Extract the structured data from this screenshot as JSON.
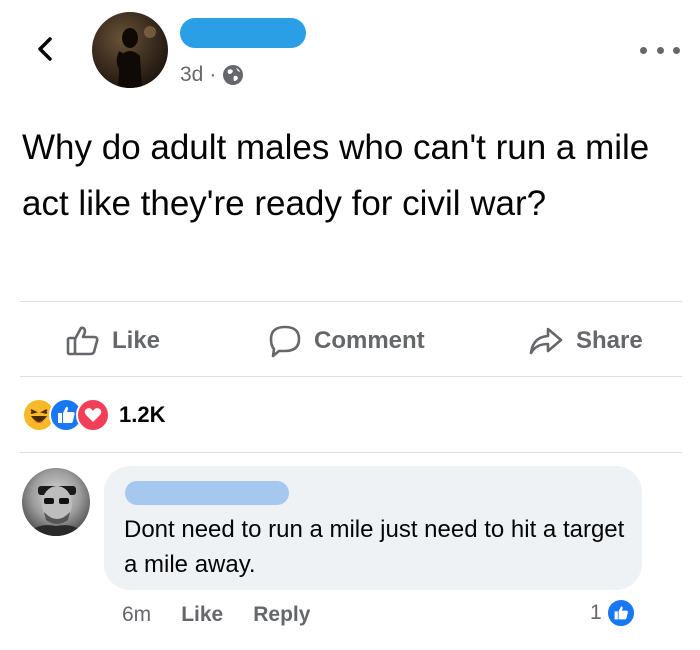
{
  "post": {
    "time": "3d",
    "separator": "·",
    "audience_icon": "globe-icon",
    "text": "Why do adult males who can't run a mile act like they're ready for civil war?"
  },
  "actions": {
    "like_label": "Like",
    "comment_label": "Comment",
    "share_label": "Share"
  },
  "reactions": {
    "types": [
      "haha",
      "like",
      "love"
    ],
    "count": "1.2K"
  },
  "comment": {
    "text": "Dont need to run a mile just need to hit a target a mile away.",
    "time": "6m",
    "like_label": "Like",
    "reply_label": "Reply",
    "like_count": "1"
  },
  "colors": {
    "name_redaction": "#2a9fe6",
    "commenter_redaction": "#a6c8ee",
    "like_blue": "#1877f2",
    "love_red": "#f33e58",
    "haha_yellow": "#f7b928",
    "meta_gray": "#65676b"
  }
}
